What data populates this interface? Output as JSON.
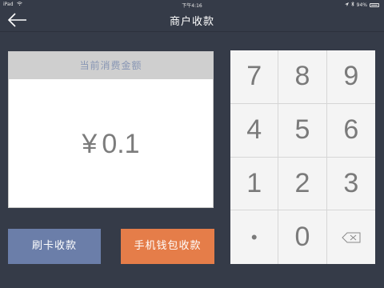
{
  "status": {
    "device": "iPad",
    "time": "下午4:16",
    "battery": "94%",
    "battery_level": 0.94
  },
  "nav": {
    "title": "商户收款"
  },
  "amount": {
    "header": "当前消费金额",
    "currency": "¥",
    "value": "0.1"
  },
  "buttons": {
    "card": "刷卡收款",
    "wallet": "手机钱包收款"
  },
  "keypad": {
    "k7": "7",
    "k8": "8",
    "k9": "9",
    "k4": "4",
    "k5": "5",
    "k6": "6",
    "k1": "1",
    "k2": "2",
    "k3": "3",
    "dot": "•",
    "k0": "0"
  },
  "colors": {
    "background": "#353b48",
    "card_button": "#6b7ea9",
    "wallet_button": "#e57d49"
  }
}
